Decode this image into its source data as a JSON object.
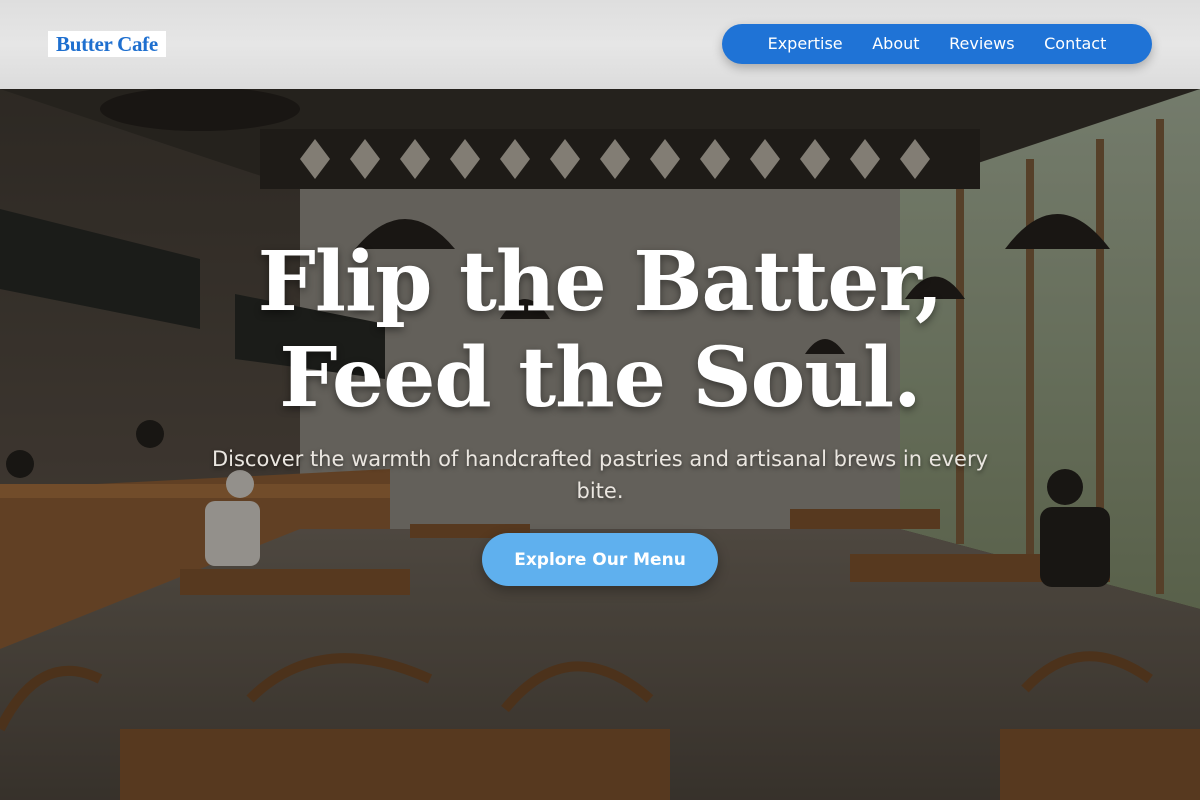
{
  "header": {
    "logo": "Butter Cafe",
    "nav": [
      {
        "label": "Expertise"
      },
      {
        "label": "About"
      },
      {
        "label": "Reviews"
      },
      {
        "label": "Contact"
      }
    ]
  },
  "hero": {
    "title_line1": "Flip the Batter,",
    "title_line2": "Feed the Soul.",
    "subtitle": "Discover the warmth of handcrafted pastries and artisanal brews in every bite.",
    "cta_label": "Explore Our Menu",
    "background": "cafe-interior-photo"
  },
  "colors": {
    "brand_blue": "#1f73d6",
    "cta_blue": "#5fb0ee",
    "header_bg": "#e2e2e2"
  }
}
